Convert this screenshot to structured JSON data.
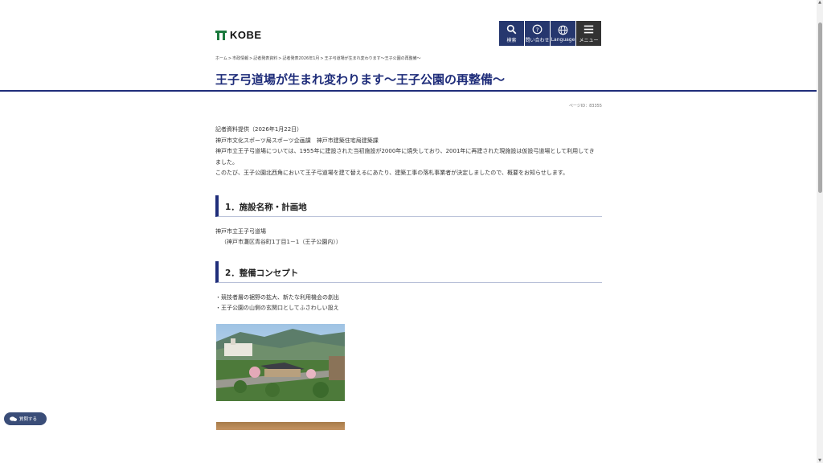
{
  "header": {
    "logo_text": "KOBE",
    "nav": [
      {
        "label": "検索",
        "icon": "search-icon"
      },
      {
        "label": "問い合わせ",
        "icon": "question-icon"
      },
      {
        "label": "Language",
        "icon": "globe-icon"
      },
      {
        "label": "メニュー",
        "icon": "menu-icon"
      }
    ]
  },
  "breadcrumb": [
    "ホーム",
    "市政情報",
    "記者発表資料",
    "記者発表2026年1月",
    "王子弓道場が生まれ変わります〜王子公園の再整備〜"
  ],
  "page": {
    "title": "王子弓道場が生まれ変わります〜王子公園の再整備〜",
    "page_id": "ページID：83355"
  },
  "intro": [
    "記者資料提供（2026年1月22日）",
    "神戸市文化スポーツ局スポーツ企画課　神戸市建築住宅局建築課",
    "神戸市立王子弓道場については、1955年に建設された当初施設が2000年に焼失しており、2001年に再建された現施設は仮設弓道場として利用してき",
    "ました。",
    "このたび、王子公園北西角において王子弓道場を建て替えるにあたり、建築工事の落札事業者が決定しましたので、概要をお知らせします。"
  ],
  "section1": {
    "heading": "1．施設名称・計画地",
    "lines": [
      "神戸市立王子弓道場",
      "（神戸市灘区青谷町1丁目1－1（王子公園内））"
    ]
  },
  "section2": {
    "heading": "2．整備コンセプト",
    "lines": [
      "・競技者層の裾野の拡大、新たな利用機会の創出",
      "・王子公園の山側の玄関口としてふさわしい設え"
    ]
  },
  "read_aloud": {
    "label": "質問する"
  },
  "colors": {
    "brand_navy": "#1f2d7a",
    "nav_bg": "#26376e",
    "menu_bg": "#333333"
  }
}
